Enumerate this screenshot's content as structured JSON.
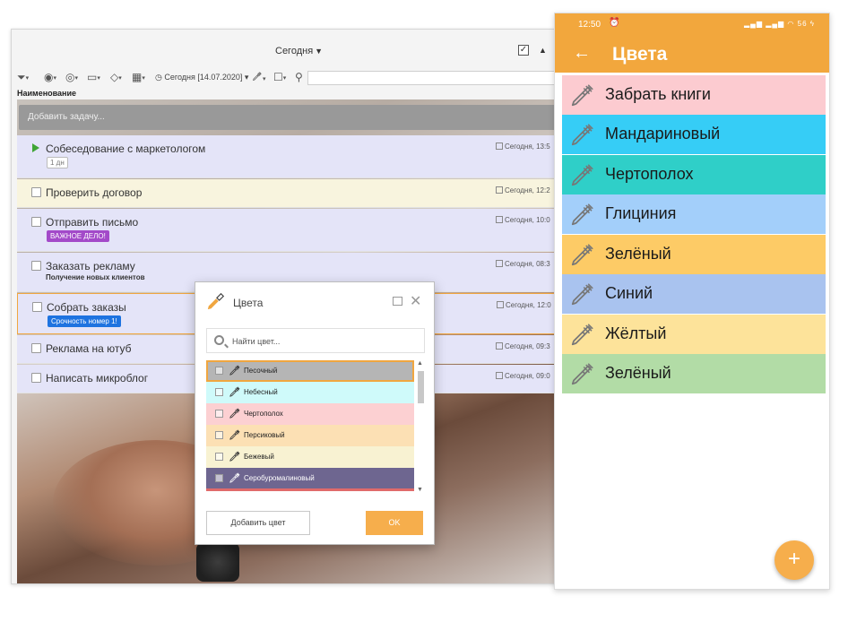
{
  "desktop": {
    "view_title": "Сегодня",
    "toolbar_date": "Сегодня [14.07.2020]",
    "column_header": "Наименование",
    "add_task_placeholder": "Добавить задачу...",
    "tasks": [
      {
        "title": "Собеседование с маркетологом",
        "tag": "1 дн",
        "date": "Сегодня, 13:5"
      },
      {
        "title": "Проверить договор",
        "date": "Сегодня, 12:2"
      },
      {
        "title": "Отправить письмо",
        "tag": "ВАЖНОЕ ДЕЛО!",
        "date": "Сегодня, 10:0"
      },
      {
        "title": "Заказать рекламу",
        "subtitle": "Получение новых клиентов",
        "date": "Сегодня, 08:3"
      },
      {
        "title": "Собрать заказы",
        "tag": "Срочность номер 1!",
        "date": "Сегодня, 12:0"
      },
      {
        "title": "Реклама на ютуб",
        "date": "Сегодня, 09:3"
      },
      {
        "title": "Написать микроблог",
        "date": "Сегодня, 09:0"
      }
    ]
  },
  "dialog": {
    "title": "Цвета",
    "search_placeholder": "Найти цвет...",
    "colors": [
      {
        "name": "Песочный",
        "color": "#b5b5b5"
      },
      {
        "name": "Небесный",
        "color": "#cffafa"
      },
      {
        "name": "Чертополох",
        "color": "#fcd0d2"
      },
      {
        "name": "Персиковый",
        "color": "#fce0b4"
      },
      {
        "name": "Бежевый",
        "color": "#f8f2d2"
      },
      {
        "name": "Серобуромалиновый",
        "color": "#6e6690"
      }
    ],
    "add_label": "Добавить цвет",
    "ok_label": "OK",
    "accent": "#f6ae4c"
  },
  "phone": {
    "time": "12:50",
    "status_right": "56",
    "title": "Цвета",
    "accent": "#f2a73d",
    "items": [
      {
        "name": "Забрать книги",
        "color": "#fccbd0"
      },
      {
        "name": "Мандариновый",
        "color": "#36cdf6"
      },
      {
        "name": "Чертополох",
        "color": "#2fcfc8"
      },
      {
        "name": "Глициния",
        "color": "#a3cffa"
      },
      {
        "name": "Зелёный",
        "color": "#fdcb66"
      },
      {
        "name": "Синий",
        "color": "#a9c3ef"
      },
      {
        "name": "Жёлтый",
        "color": "#fde39a"
      },
      {
        "name": "Зелёный",
        "color": "#b2dca6"
      }
    ],
    "fab_label": "+"
  }
}
